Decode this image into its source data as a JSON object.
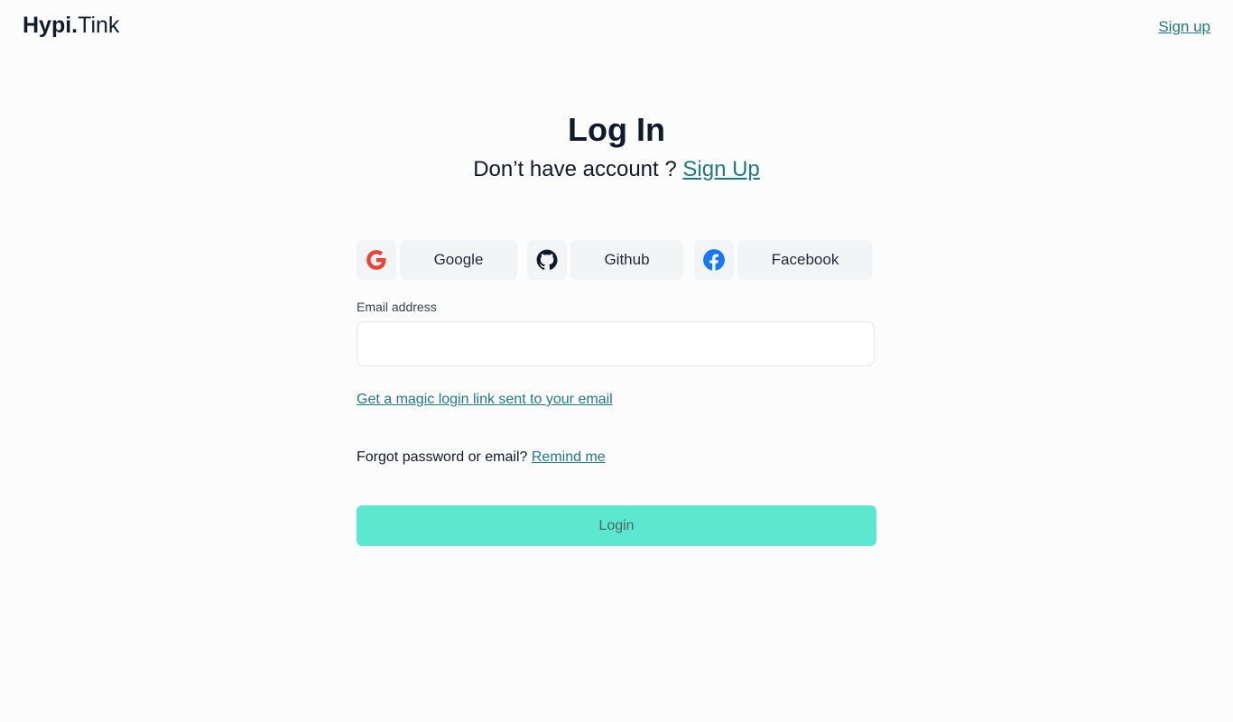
{
  "header": {
    "logo_bold": "Hypi.",
    "logo_light": "Tink",
    "signup_link": "Sign up"
  },
  "main": {
    "title": "Log In",
    "subtitle_text": "Don’t have account ? ",
    "subtitle_link": "Sign Up"
  },
  "social": {
    "google": {
      "label": "Google",
      "icon": "google-icon"
    },
    "github": {
      "label": "Github",
      "icon": "github-icon"
    },
    "facebook": {
      "label": "Facebook",
      "icon": "facebook-icon"
    }
  },
  "form": {
    "email_label": "Email address",
    "email_value": "",
    "email_placeholder": "",
    "magic_link": "Get a magic login link sent to your email",
    "forgot_text": "Forgot password or email? ",
    "forgot_link": "Remind me",
    "login_button": "Login"
  },
  "colors": {
    "accent": "#1f7a80",
    "login_button": "#5ce8cf",
    "google_red": "#ea4335",
    "facebook_blue": "#1877f2"
  }
}
